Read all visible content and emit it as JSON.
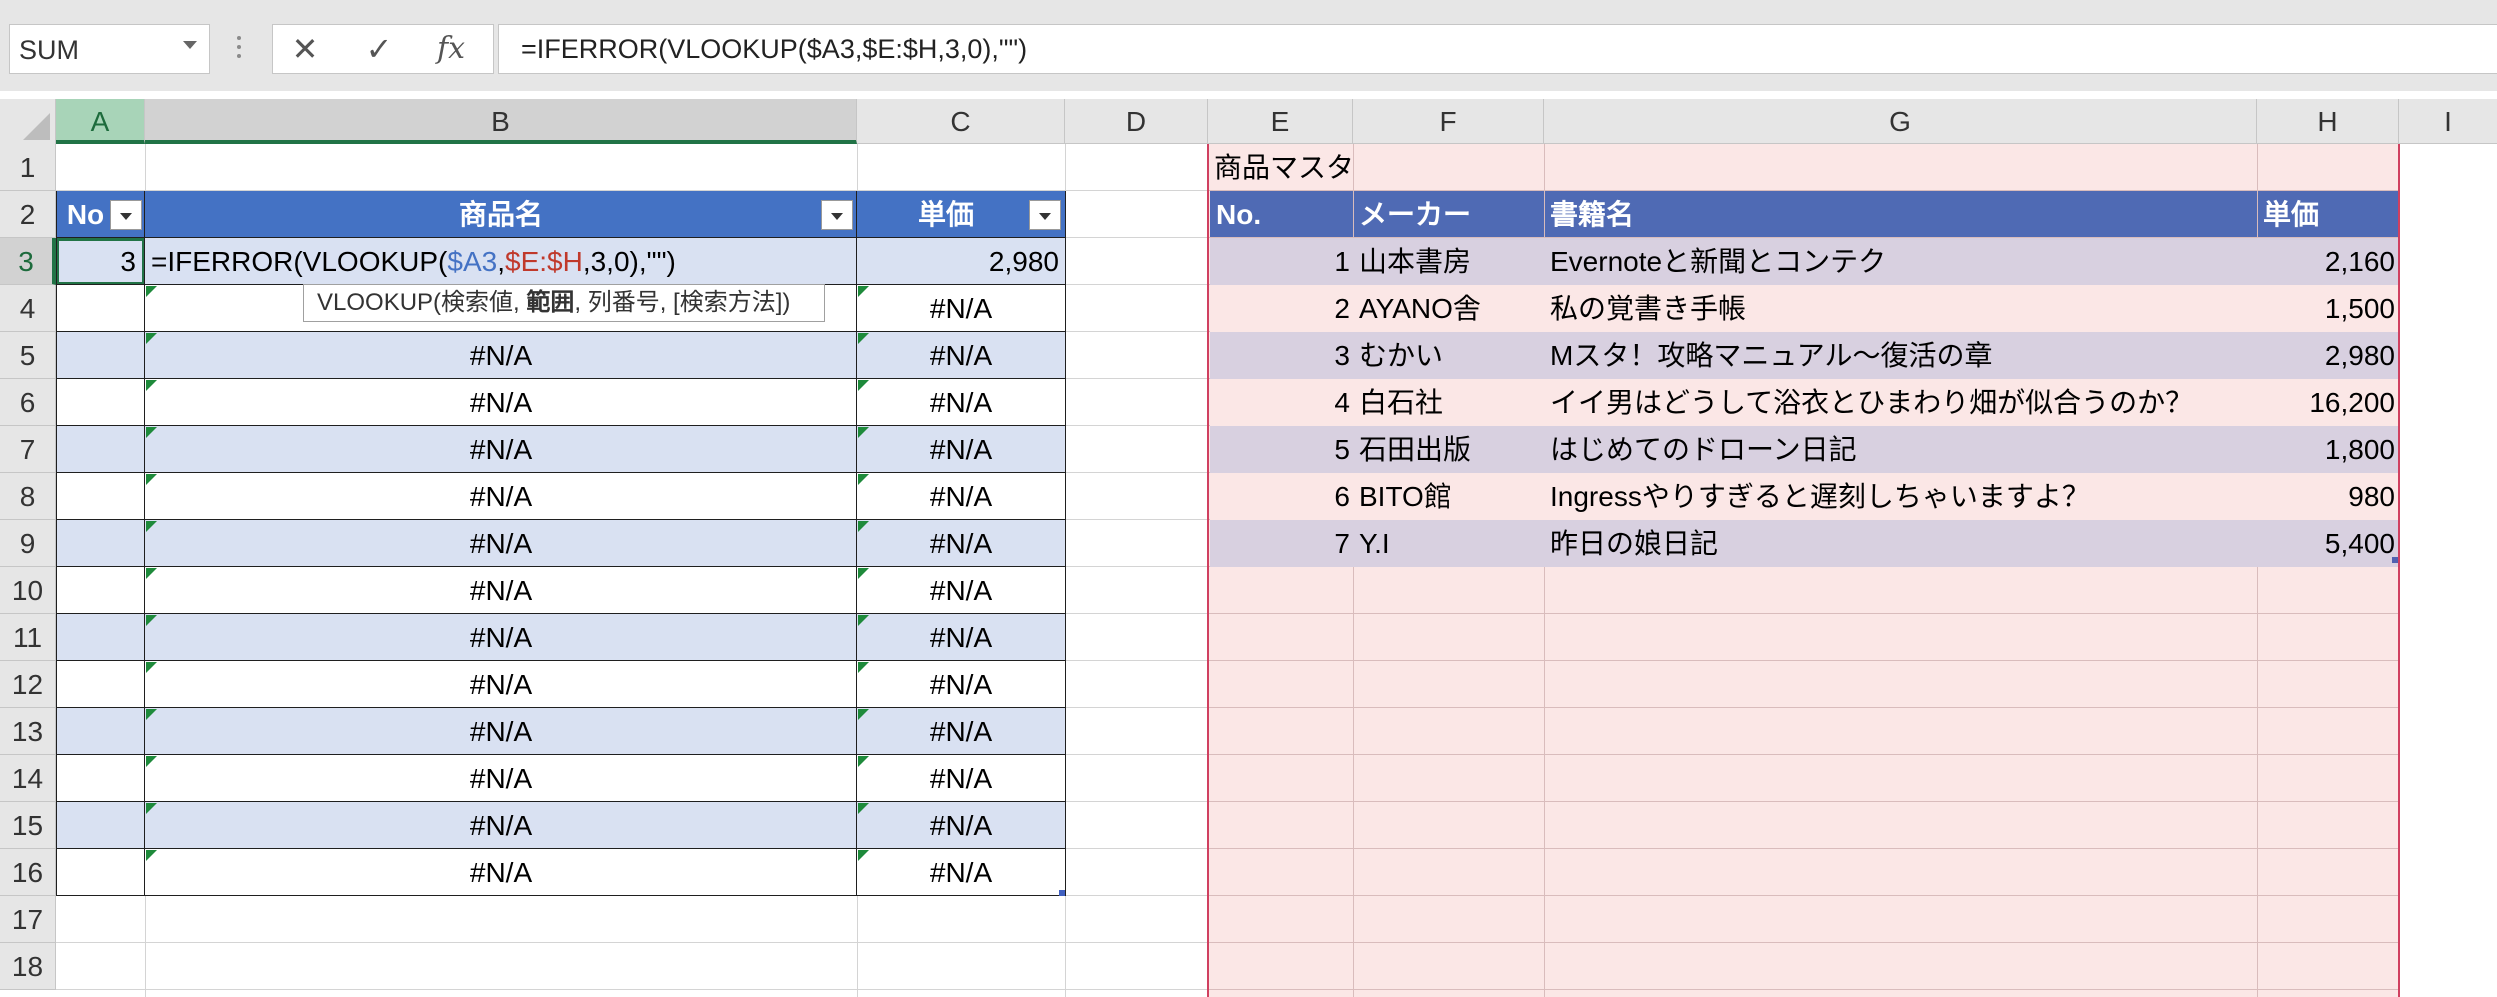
{
  "formula_bar": {
    "name_box": "SUM",
    "cancel_icon": "✕",
    "enter_icon": "✓",
    "fx_label": "fx",
    "formula": "=IFERROR(VLOOKUP($A3,$E:$H,3,0),\"\")"
  },
  "columns": [
    "A",
    "B",
    "C",
    "D",
    "E",
    "F",
    "G",
    "H",
    "I"
  ],
  "rows": [
    "1",
    "2",
    "3",
    "4",
    "5",
    "6",
    "7",
    "8",
    "9",
    "10",
    "11",
    "12",
    "13",
    "14",
    "15",
    "16",
    "17",
    "18"
  ],
  "order_table": {
    "headers": {
      "no": "No",
      "name": "商品名",
      "price": "単価"
    },
    "edit_row": {
      "no": "3",
      "formula_parts": [
        "=IFERROR(VLOOKUP(",
        "$A3",
        ",",
        "$E:$H",
        ",3,0),\"\")"
      ],
      "price": "2,980"
    },
    "error_value": "#N/A"
  },
  "tooltip": {
    "prefix": "VLOOKUP(検索値, ",
    "bold": "範囲",
    "suffix": ", 列番号, [検索方法])"
  },
  "master": {
    "title": "商品マスタ",
    "headers": {
      "no": "No.",
      "maker": "メーカー",
      "title": "書籍名",
      "price": "単価"
    },
    "rows": [
      {
        "no": "1",
        "maker": "山本書房",
        "title": "Evernoteと新聞とコンテク",
        "price": "2,160"
      },
      {
        "no": "2",
        "maker": "AYANO舎",
        "title": "私の覚書き手帳",
        "price": "1,500"
      },
      {
        "no": "3",
        "maker": "むかい",
        "title": "Mスタ！攻略マニュアル～復活の章",
        "price": "2,980"
      },
      {
        "no": "4",
        "maker": "白石社",
        "title": "イイ男はどうして浴衣とひまわり畑が似合うのか？",
        "price": "16,200"
      },
      {
        "no": "5",
        "maker": "石田出版",
        "title": "はじめてのドローン日記",
        "price": "1,800"
      },
      {
        "no": "6",
        "maker": "BITO館",
        "title": "Ingressやりすぎると遅刻しちゃいますよ？",
        "price": "980"
      },
      {
        "no": "7",
        "maker": "Y.I",
        "title": "昨日の娘日記",
        "price": "5,400"
      }
    ]
  },
  "colors": {
    "table_header": "#4472c4",
    "table_band": "#d9e1f2",
    "master_header": "#4f6ab4",
    "master_band": "#d8d0e0",
    "master_bg": "#fbe7e6",
    "ref_a3": "#4472c4",
    "ref_range": "#c0392b",
    "selection": "#217346"
  }
}
